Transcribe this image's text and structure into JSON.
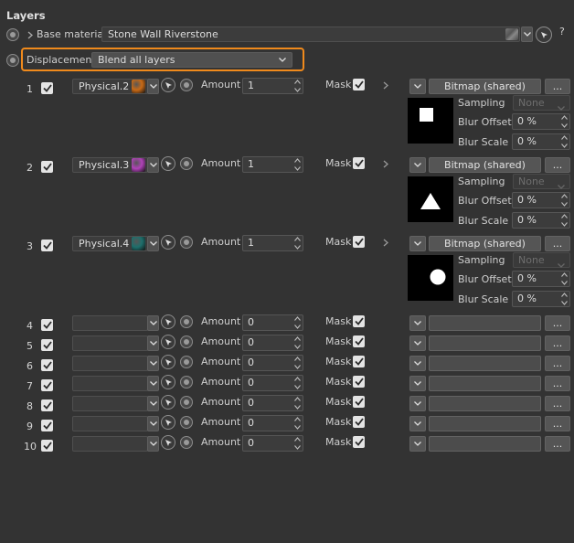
{
  "panel": {
    "title": "Layers",
    "help_label": "?"
  },
  "base_material": {
    "label": "Base material",
    "value": "Stone Wall Riverstone"
  },
  "displacement": {
    "label": "Displacement",
    "mode": "Blend all layers"
  },
  "common": {
    "amount_label": "Amount",
    "mask_label": "Mask",
    "bitmap_label": "Bitmap (shared)",
    "ellipsis": "...",
    "sampling_label": "Sampling",
    "sampling_value": "None",
    "blur_offset_label": "Blur Offset",
    "blur_scale_label": "Blur Scale",
    "blur_offset_value": "0 %",
    "blur_scale_value": "0 %"
  },
  "layers": [
    {
      "index": "1",
      "material": "Physical.2",
      "amount": "1",
      "swatch": "#c96a16",
      "shape": "square"
    },
    {
      "index": "2",
      "material": "Physical.3",
      "amount": "1",
      "swatch": "#b042b8",
      "shape": "triangle"
    },
    {
      "index": "3",
      "material": "Physical.4",
      "amount": "1",
      "swatch": "#1d6f6c",
      "shape": "circle"
    },
    {
      "index": "4",
      "material": "",
      "amount": "0"
    },
    {
      "index": "5",
      "material": "",
      "amount": "0"
    },
    {
      "index": "6",
      "material": "",
      "amount": "0"
    },
    {
      "index": "7",
      "material": "",
      "amount": "0"
    },
    {
      "index": "8",
      "material": "",
      "amount": "0"
    },
    {
      "index": "9",
      "material": "",
      "amount": "0"
    },
    {
      "index": "10",
      "material": "",
      "amount": "0"
    }
  ],
  "colors": {
    "highlight": "#f08a1c",
    "background": "#333333"
  }
}
